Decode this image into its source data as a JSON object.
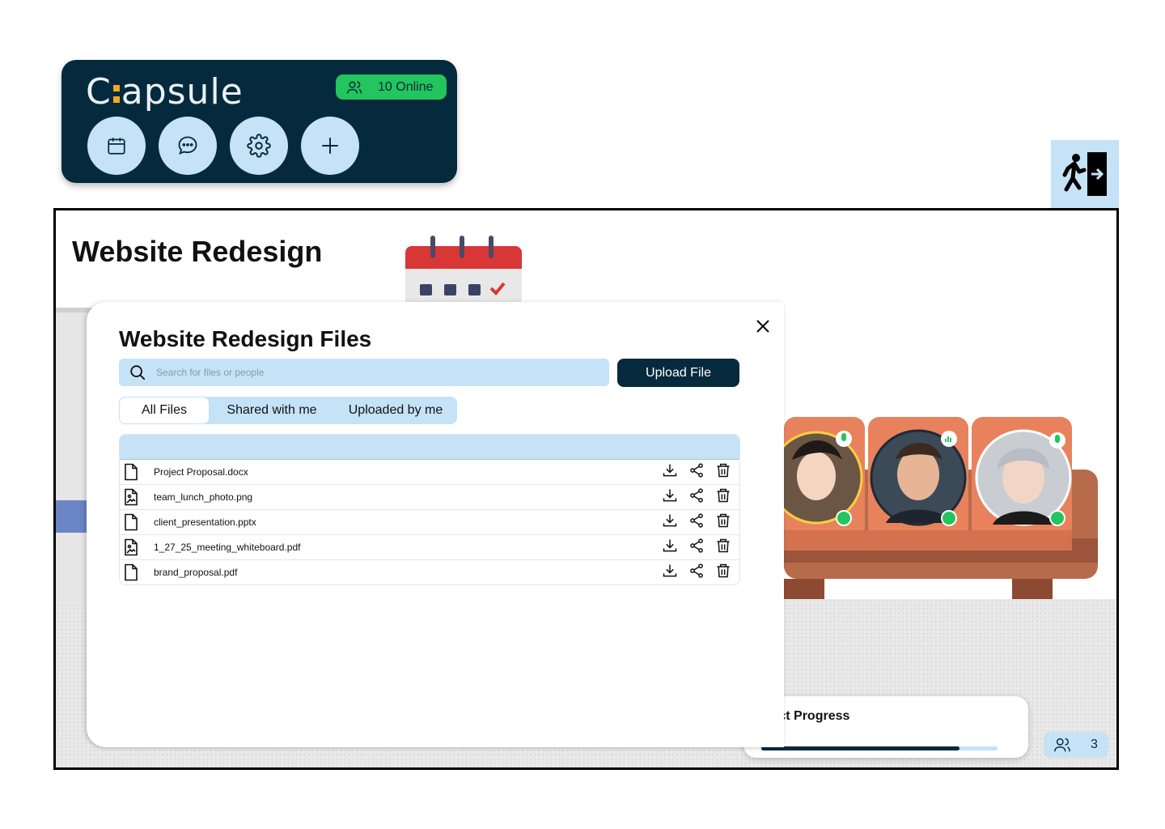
{
  "brand": {
    "logo_prefix": "C",
    "logo_suffix": "apsule",
    "online_label": "10 Online",
    "accent": "#f5a623",
    "panel_color": "#062a3d",
    "online_color": "#22c55e"
  },
  "toolbar": {
    "buttons": [
      {
        "icon": "calendar-icon"
      },
      {
        "icon": "chat-icon"
      },
      {
        "icon": "gear-icon"
      },
      {
        "icon": "plus-icon"
      }
    ]
  },
  "exit": {
    "icon": "exit-icon"
  },
  "room": {
    "title": "Website Redesign"
  },
  "modal": {
    "title": "Website Redesign Files",
    "search_placeholder": "Search for files or people",
    "upload_label": "Upload File",
    "tabs": [
      {
        "label": "All Files",
        "active": true
      },
      {
        "label": "Shared with me"
      },
      {
        "label": "Uploaded by me"
      }
    ],
    "files": [
      {
        "name": "Project Proposal.docx",
        "type": "doc"
      },
      {
        "name": "team_lunch_photo.png",
        "type": "image"
      },
      {
        "name": "client_presentation.pptx",
        "type": "doc"
      },
      {
        "name": "1_27_25_meeting_whiteboard.pdf",
        "type": "image"
      },
      {
        "name": "brand_proposal.pdf",
        "type": "doc"
      }
    ]
  },
  "progress": {
    "title_visible": "ject Progress",
    "pct_visible": "%",
    "fraction": 0.84
  },
  "people": {
    "count": "3"
  }
}
